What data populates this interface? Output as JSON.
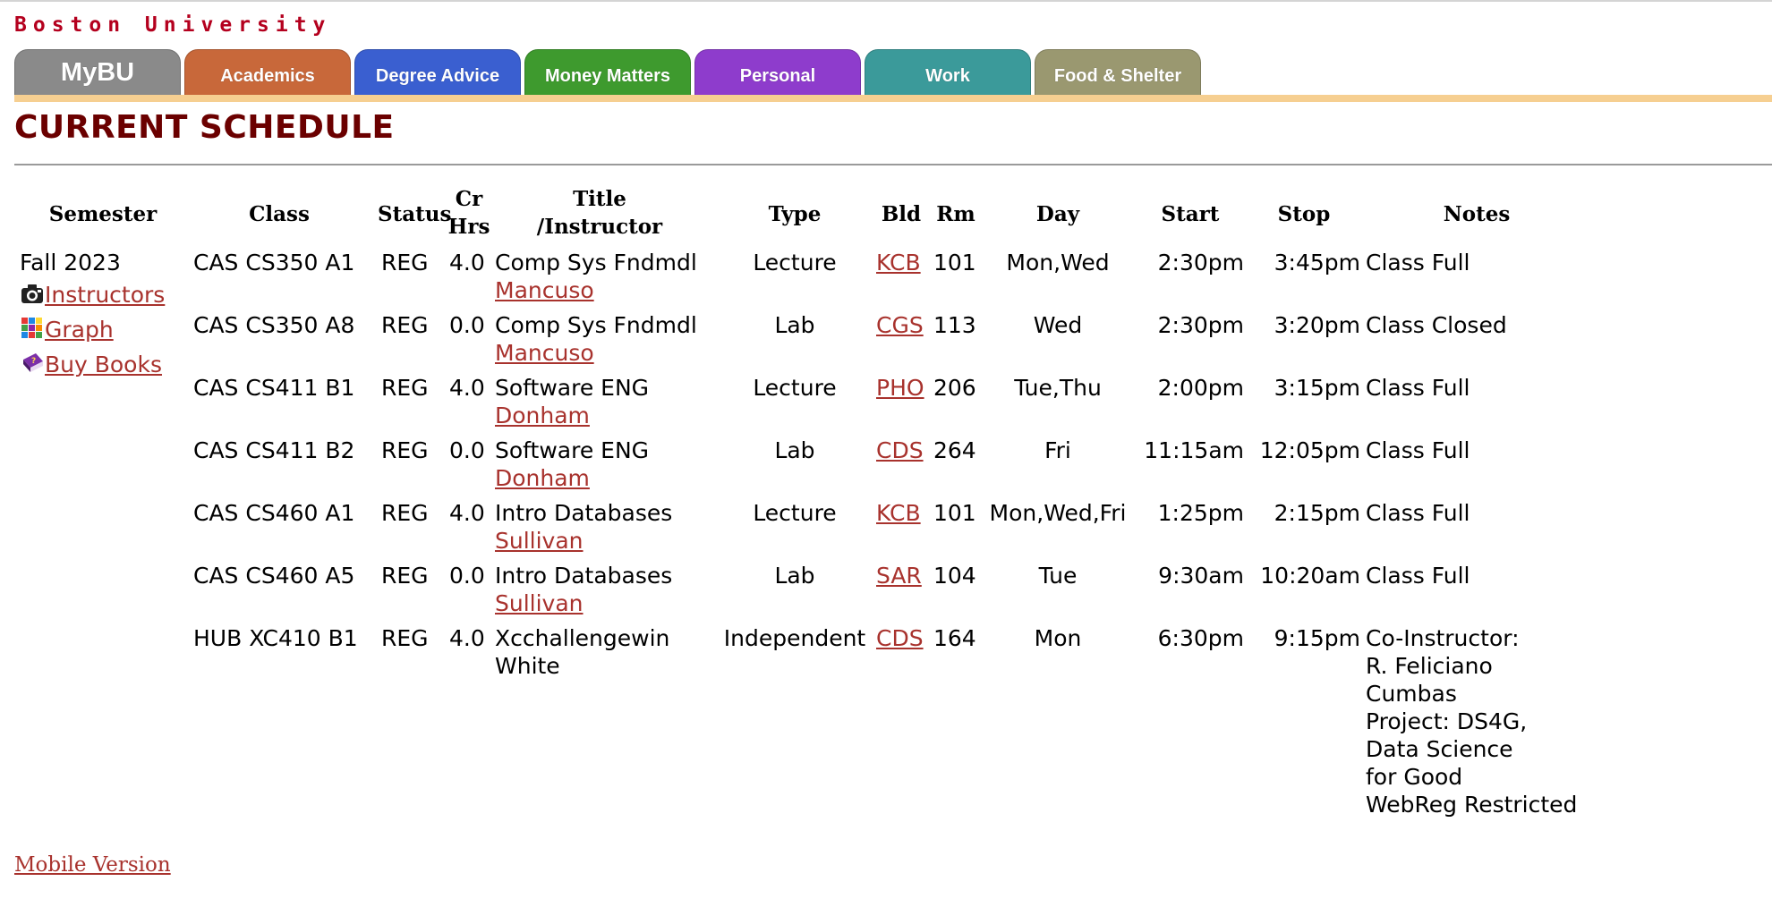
{
  "brand": "Boston University",
  "tabs": [
    {
      "label": "MyBU",
      "color": "#8a8a8a"
    },
    {
      "label": "Academics",
      "color": "#c8683a"
    },
    {
      "label": "Degree Advice",
      "color": "#3a5fd0"
    },
    {
      "label": "Money Matters",
      "color": "#3e9a2e"
    },
    {
      "label": "Personal",
      "color": "#8e3ccc"
    },
    {
      "label": "Work",
      "color": "#3b9a9a"
    },
    {
      "label": "Food & Shelter",
      "color": "#9a9870"
    }
  ],
  "page_title": "CURRENT SCHEDULE",
  "headers": {
    "semester": "Semester",
    "class": "Class",
    "status": "Status",
    "cr1": "Cr",
    "cr2": "Hrs",
    "title1": "Title",
    "title2": "/Instructor",
    "type": "Type",
    "bld": "Bld",
    "rm": "Rm",
    "day": "Day",
    "start": "Start",
    "stop": "Stop",
    "notes": "Notes"
  },
  "semester": "Fall 2023",
  "sidebar_links": [
    {
      "label": "Instructors",
      "icon": "camera-icon"
    },
    {
      "label": "Graph",
      "icon": "grid-icon"
    },
    {
      "label": "Buy Books",
      "icon": "book-icon"
    }
  ],
  "rows": [
    {
      "class": "CAS CS350 A1",
      "status": "REG",
      "cr": "4.0",
      "title": "Comp Sys Fndmdl",
      "instructor": "Mancuso",
      "instructor_link": true,
      "type": "Lecture",
      "bld": "KCB",
      "rm": "101",
      "day": "Mon,Wed",
      "start": "2:30pm",
      "stop": "3:45pm",
      "notes": [
        "Class Full"
      ]
    },
    {
      "class": "CAS CS350 A8",
      "status": "REG",
      "cr": "0.0",
      "title": "Comp Sys Fndmdl",
      "instructor": "Mancuso",
      "instructor_link": true,
      "type": "Lab",
      "bld": "CGS",
      "rm": "113",
      "day": "Wed",
      "start": "2:30pm",
      "stop": "3:20pm",
      "notes": [
        "Class Closed"
      ]
    },
    {
      "class": "CAS CS411 B1",
      "status": "REG",
      "cr": "4.0",
      "title": "Software ENG",
      "instructor": "Donham",
      "instructor_link": true,
      "type": "Lecture",
      "bld": "PHO",
      "rm": "206",
      "day": "Tue,Thu",
      "start": "2:00pm",
      "stop": "3:15pm",
      "notes": [
        "Class Full"
      ]
    },
    {
      "class": "CAS CS411 B2",
      "status": "REG",
      "cr": "0.0",
      "title": "Software ENG",
      "instructor": "Donham",
      "instructor_link": true,
      "type": "Lab",
      "bld": "CDS",
      "rm": "264",
      "day": "Fri",
      "start": "11:15am",
      "stop": "12:05pm",
      "notes": [
        "Class Full"
      ]
    },
    {
      "class": "CAS CS460 A1",
      "status": "REG",
      "cr": "4.0",
      "title": "Intro Databases",
      "instructor": "Sullivan",
      "instructor_link": true,
      "type": "Lecture",
      "bld": "KCB",
      "rm": "101",
      "day": "Mon,Wed,Fri",
      "start": "1:25pm",
      "stop": "2:15pm",
      "notes": [
        "Class Full"
      ]
    },
    {
      "class": "CAS CS460 A5",
      "status": "REG",
      "cr": "0.0",
      "title": "Intro Databases",
      "instructor": "Sullivan",
      "instructor_link": true,
      "type": "Lab",
      "bld": "SAR",
      "rm": "104",
      "day": "Tue",
      "start": "9:30am",
      "stop": "10:20am",
      "notes": [
        "Class Full"
      ]
    },
    {
      "class": "HUB XC410 B1",
      "status": "REG",
      "cr": "4.0",
      "title": "Xcchallengewin",
      "instructor": "White",
      "instructor_link": false,
      "type": "Independent",
      "bld": "CDS",
      "rm": "164",
      "day": "Mon",
      "start": "6:30pm",
      "stop": "9:15pm",
      "notes": [
        "Co-Instructor:",
        "R. Feliciano",
        "Cumbas",
        "Project: DS4G,",
        "Data Science",
        "for Good",
        "WebReg Restricted"
      ]
    }
  ],
  "mobile_link": "Mobile Version"
}
